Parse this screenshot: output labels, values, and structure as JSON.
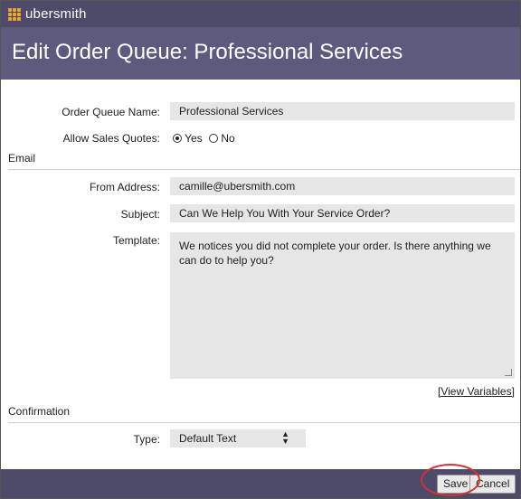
{
  "app": {
    "name": "ubersmith",
    "logo_icon": "grid-dots-icon",
    "accent": "#f2a72a"
  },
  "page": {
    "title": "Edit Order Queue: Professional Services"
  },
  "form": {
    "queue_name_label": "Order Queue Name:",
    "queue_name_value": "Professional Services",
    "sales_quotes_label": "Allow Sales Quotes:",
    "sales_quotes_yes": "Yes",
    "sales_quotes_no": "No",
    "sales_quotes_selected": "Yes"
  },
  "email": {
    "section_title": "Email",
    "from_label": "From Address:",
    "from_value": "camille@ubersmith.com",
    "subject_label": "Subject:",
    "subject_value": "Can We Help You With Your Service Order?",
    "template_label": "Template:",
    "template_value": "We notices you did not complete your order. Is there anything we can do to help you?",
    "view_variables": "[View Variables]"
  },
  "confirmation": {
    "section_title": "Confirmation",
    "type_label": "Type:",
    "type_value": "Default Text"
  },
  "footer": {
    "save_label": "Save",
    "cancel_label": "Cancel",
    "highlight_color": "#d9302b"
  }
}
